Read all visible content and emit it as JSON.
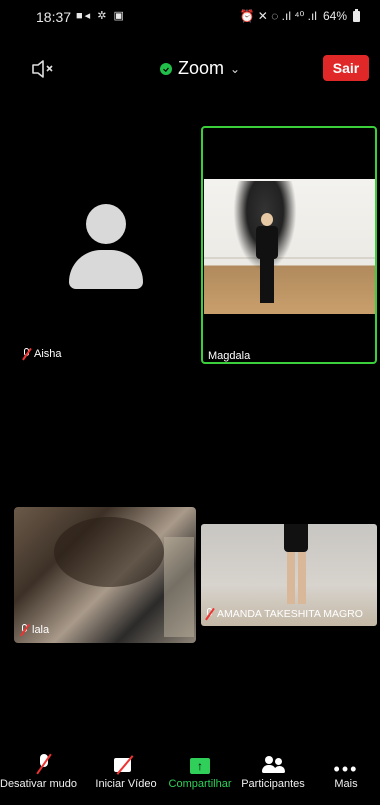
{
  "status_bar": {
    "time": "18:37",
    "left_icons": "■◂ ✲ ▣",
    "right_icons": "⏰ ✕ ◌ .ıl ⁴⁰ .ıl",
    "battery": "64%"
  },
  "meeting": {
    "title": "Zoom",
    "leave_label": "Sair"
  },
  "participants": [
    {
      "name": "Aisha",
      "video": "off"
    },
    {
      "name": "Magdala",
      "video": "on",
      "active_speaker": true
    },
    {
      "name": "lala",
      "video": "on"
    },
    {
      "name": "AMANDA TAKESHITA MAGRO",
      "video": "on"
    }
  ],
  "toolbar": {
    "mute_label": "Desativar mudo",
    "video_label": "Iniciar Vídeo",
    "share_label": "Compartilhar",
    "participants_label": "Participantes",
    "more_label": "Mais"
  },
  "colors": {
    "leave": "#e02828",
    "share": "#2fcf5a",
    "active_border": "#3bd03b",
    "shield": "#21c04a"
  },
  "icons": [
    "speaker-off-icon",
    "shield-check-icon",
    "chevron-down-icon",
    "mic-muted-icon",
    "camera-off-icon",
    "share-screen-icon",
    "participants-icon",
    "more-icon"
  ]
}
